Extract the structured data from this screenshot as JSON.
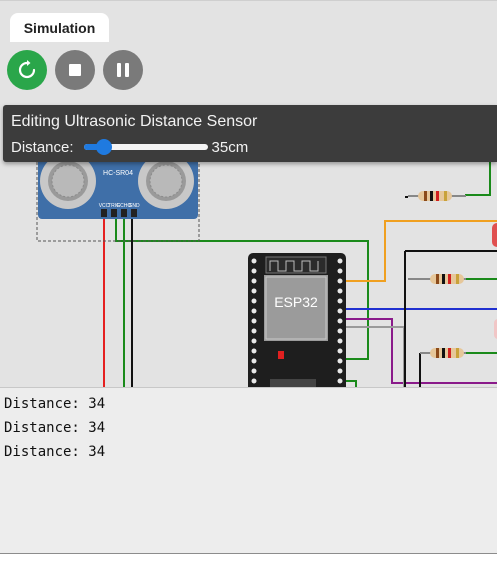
{
  "tabs": {
    "simulation": "Simulation"
  },
  "controls": {
    "restart": {
      "icon": "restart-icon",
      "color": "#2aa64a"
    },
    "stop": {
      "icon": "stop-icon",
      "color": "#7a7a7a"
    },
    "pause": {
      "icon": "pause-icon",
      "color": "#7a7a7a"
    }
  },
  "editor": {
    "title": "Editing Ultrasonic Distance Sensor",
    "distance_label": "Distance:",
    "distance_value": 35,
    "distance_min": 2,
    "distance_max": 400,
    "distance_display": "35cm"
  },
  "circuit": {
    "sensor_model": "HC-SR04",
    "sensor_pins": [
      "VCC",
      "TRIG",
      "ECHO",
      "GND"
    ],
    "board_label": "ESP32"
  },
  "serial_monitor": {
    "lines": [
      "Distance: 34",
      "Distance: 34",
      "Distance: 34"
    ]
  }
}
